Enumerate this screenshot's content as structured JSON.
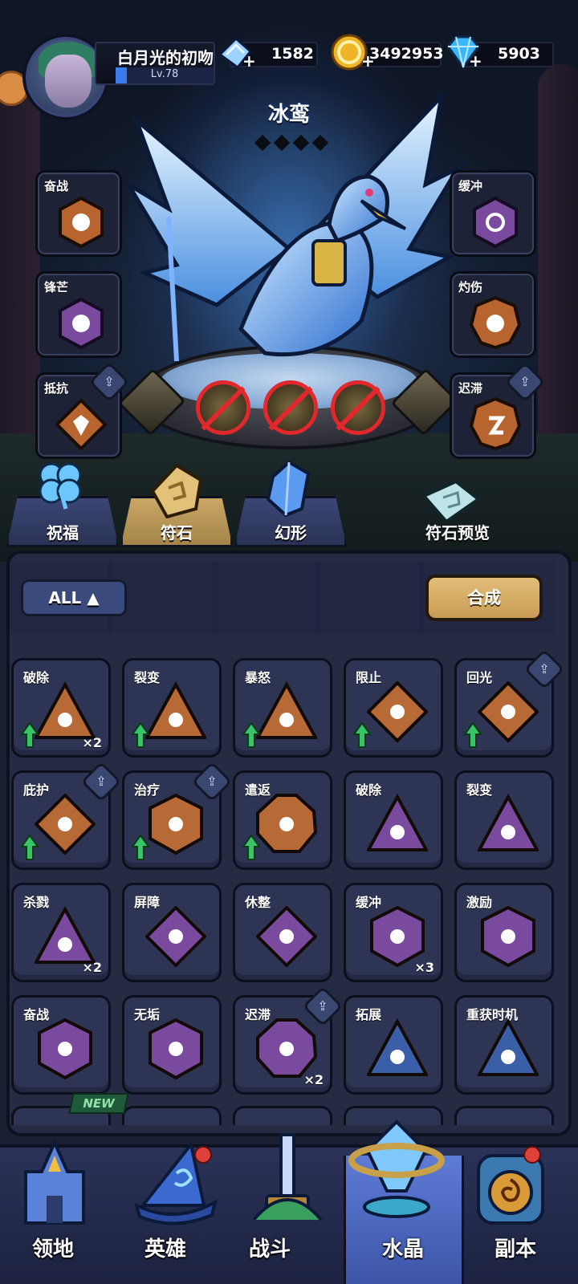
{
  "player": {
    "name": "白月光的初吻",
    "level": "Lv.78"
  },
  "resources": [
    {
      "icon": "ice-crystal-icon",
      "value": "1582"
    },
    {
      "icon": "gold-coin-icon",
      "value": "3492953"
    },
    {
      "icon": "diamond-icon",
      "value": "5903"
    }
  ],
  "hero": {
    "name": "冰鸾",
    "stars": 4
  },
  "left_slots": [
    {
      "label": "奋战",
      "locked": false
    },
    {
      "label": "锋芒",
      "locked": false
    },
    {
      "label": "抵抗",
      "locked": true
    }
  ],
  "right_slots": [
    {
      "label": "缓冲",
      "locked": false
    },
    {
      "label": "灼伤",
      "locked": false
    },
    {
      "label": "迟滞",
      "locked": true
    }
  ],
  "tabs": [
    {
      "label": "祝福",
      "icon": "clover-icon"
    },
    {
      "label": "符石",
      "icon": "rune-stone-icon",
      "active": true
    },
    {
      "label": "幻形",
      "icon": "blue-crystal-icon"
    },
    {
      "label": "符石预览",
      "icon": "rune-book-icon"
    }
  ],
  "filter": {
    "all_label": "ALL"
  },
  "synthesize_label": "合成",
  "runes": [
    {
      "label": "破除",
      "color": "#b86a36",
      "shape": "triangle",
      "count": "×2",
      "up": true
    },
    {
      "label": "裂变",
      "color": "#b86a36",
      "shape": "triangle",
      "count": "",
      "up": true
    },
    {
      "label": "暴怒",
      "color": "#b86a36",
      "shape": "triangle",
      "count": "",
      "up": true
    },
    {
      "label": "限止",
      "color": "#b86a36",
      "shape": "diamond",
      "count": "",
      "up": true
    },
    {
      "label": "回光",
      "color": "#b86a36",
      "shape": "diamond",
      "count": "",
      "up": true,
      "locked": true
    },
    {
      "label": "庇护",
      "color": "#b86a36",
      "shape": "diamond",
      "count": "",
      "up": true,
      "locked": true
    },
    {
      "label": "治疗",
      "color": "#b86a36",
      "shape": "hex",
      "count": "",
      "up": true,
      "locked": true
    },
    {
      "label": "遣返",
      "color": "#b86a36",
      "shape": "oct",
      "count": "",
      "up": true
    },
    {
      "label": "破除",
      "color": "#7a4a9e",
      "shape": "triangle",
      "count": "",
      "up": false
    },
    {
      "label": "裂变",
      "color": "#7a4a9e",
      "shape": "triangle",
      "count": "",
      "up": false
    },
    {
      "label": "杀戮",
      "color": "#7a4a9e",
      "shape": "triangle",
      "count": "×2",
      "up": false
    },
    {
      "label": "屏障",
      "color": "#7a4a9e",
      "shape": "diamond",
      "count": "",
      "up": false
    },
    {
      "label": "休整",
      "color": "#7a4a9e",
      "shape": "diamond",
      "count": "",
      "up": false
    },
    {
      "label": "缓冲",
      "color": "#7a4a9e",
      "shape": "hex",
      "count": "×3",
      "up": false
    },
    {
      "label": "激励",
      "color": "#7a4a9e",
      "shape": "hex",
      "count": "",
      "up": false
    },
    {
      "label": "奋战",
      "color": "#7a4a9e",
      "shape": "hex",
      "count": "",
      "up": false
    },
    {
      "label": "无垢",
      "color": "#7a4a9e",
      "shape": "hex",
      "count": "",
      "up": false
    },
    {
      "label": "迟滞",
      "color": "#7a4a9e",
      "shape": "oct",
      "count": "×2",
      "up": false,
      "locked": true
    },
    {
      "label": "拓展",
      "color": "#3a5fa8",
      "shape": "triangle",
      "count": "",
      "up": false
    },
    {
      "label": "重获时机",
      "color": "#3a5fa8",
      "shape": "triangle",
      "count": "",
      "up": false
    }
  ],
  "new_badge": "NEW",
  "nav": [
    {
      "label": "领地",
      "icon": "castle-icon"
    },
    {
      "label": "英雄",
      "icon": "wizard-hat-icon",
      "dot": true
    },
    {
      "label": "战斗",
      "icon": "sword-icon"
    },
    {
      "label": "水晶",
      "icon": "crystal-icon",
      "active": true
    },
    {
      "label": "副本",
      "icon": "portal-icon",
      "dot": true
    }
  ],
  "colors": {
    "accent_gold": "#c9a765",
    "panel": "#262b44",
    "active_nav": "#4e6ac2"
  }
}
